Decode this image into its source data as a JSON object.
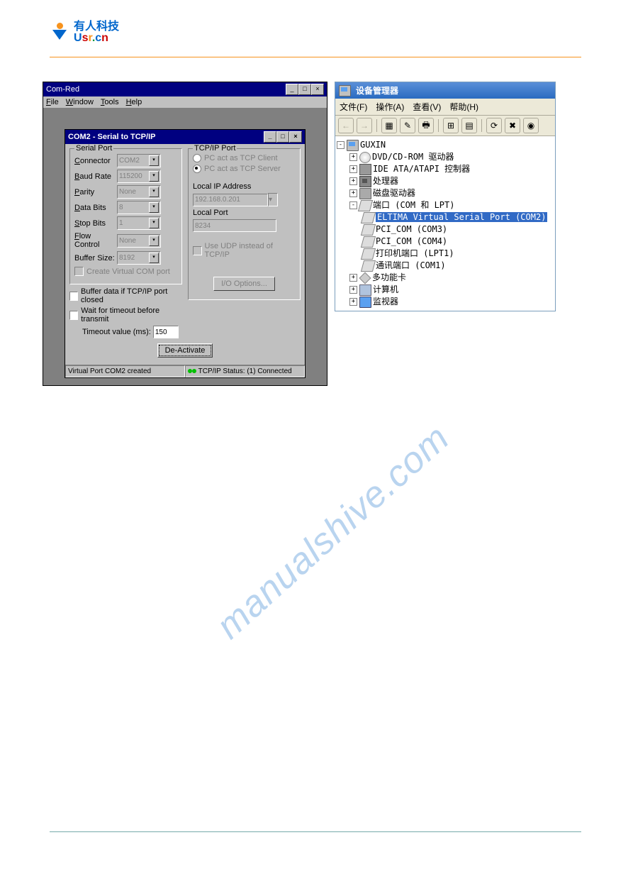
{
  "brand": {
    "cn": "有人科技",
    "usr": {
      "u": "U",
      "s": "s",
      "r": "r",
      "dot": ".",
      "c": "c",
      "n": "n"
    }
  },
  "outer": {
    "title": "Com-Red",
    "menu": {
      "file": "File",
      "window": "Window",
      "tools": "Tools",
      "help": "Help"
    }
  },
  "inner": {
    "title": "COM2 - Serial to TCP/IP",
    "serial": {
      "group": "Serial Port",
      "connector_lbl": "Connector",
      "connector_val": "COM2",
      "baud_lbl": "Baud Rate",
      "baud_val": "115200",
      "parity_lbl": "Parity",
      "parity_val": "None",
      "databits_lbl": "Data Bits",
      "databits_val": "8",
      "stopbits_lbl": "Stop Bits",
      "stopbits_val": "1",
      "flow_lbl": "Flow Control",
      "flow_val": "None",
      "buf_lbl": "Buffer Size:",
      "buf_val": "8192",
      "create_vport": "Create Virtual COM port",
      "buffer_closed": "Buffer data if TCP/IP port closed",
      "wait_timeout": "Wait for timeout before transmit",
      "timeout_lbl": "Timeout value (ms):",
      "timeout_val": "150"
    },
    "tcp": {
      "group": "TCP/IP Port",
      "client": "PC act as TCP Client",
      "server": "PC act as TCP Server",
      "lip_lbl": "Local IP Address",
      "lip_val": "192.168.0.201",
      "lport_lbl": "Local Port",
      "lport_val": "8234",
      "udp": "Use UDP instead of TCP/IP",
      "io_btn": "I/O Options..."
    },
    "act_btn": "De-Activate",
    "status": {
      "left": "Virtual Port COM2 created",
      "right": "TCP/IP Status: (1) Connected"
    }
  },
  "dm": {
    "title": "设备管理器",
    "menu": {
      "file": "文件(F)",
      "action": "操作(A)",
      "view": "查看(V)",
      "help": "帮助(H)"
    },
    "tree": {
      "root": "GUXIN",
      "dvd": "DVD/CD-ROM 驱动器",
      "ide": "IDE ATA/ATAPI 控制器",
      "cpu": "处理器",
      "disk": "磁盘驱动器",
      "ports": "端口 (COM 和 LPT)",
      "eltima": "ELTIMA Virtual Serial Port (COM2)",
      "pci3": "PCI_COM (COM3)",
      "pci4": "PCI_COM (COM4)",
      "lpt": "打印机端口 (LPT1)",
      "com1": "通讯端口 (COM1)",
      "multi": "多功能卡",
      "computer": "计算机",
      "monitor": "监视器"
    }
  },
  "watermark": "manualshive.com"
}
